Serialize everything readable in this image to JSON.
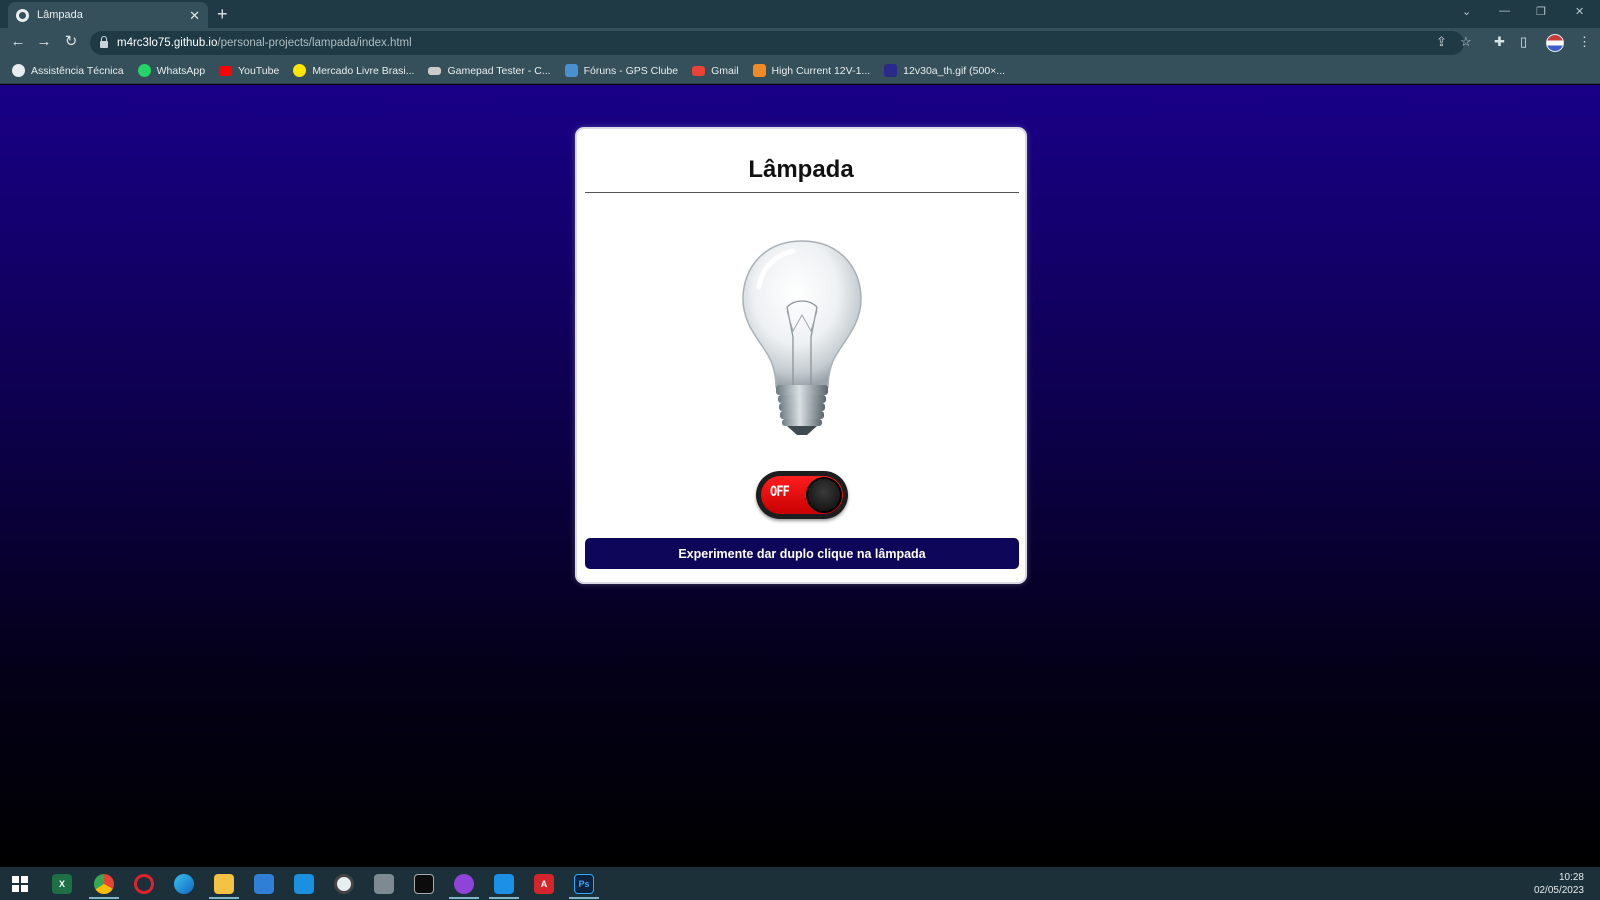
{
  "browser": {
    "tab_title": "Lâmpada",
    "tab_close": "✕",
    "new_tab": "+",
    "url_host": "m4rc3lo75.github.io",
    "url_path": "/personal-projects/lampada/index.html"
  },
  "bookmarks": [
    {
      "label": "Assistência Técnica",
      "icon": "globe-icon",
      "color": "#e8eef0"
    },
    {
      "label": "WhatsApp",
      "icon": "whatsapp-icon",
      "color": "#25d366"
    },
    {
      "label": "YouTube",
      "icon": "youtube-icon",
      "color": "#ff0000"
    },
    {
      "label": "Mercado Livre Brasi...",
      "icon": "mercado-livre-icon",
      "color": "#ffe600"
    },
    {
      "label": "Gamepad Tester - C...",
      "icon": "gamepad-icon",
      "color": "#cccccc"
    },
    {
      "label": "Fóruns - GPS Clube",
      "icon": "gps-clube-icon",
      "color": "#4a8fd0"
    },
    {
      "label": "Gmail",
      "icon": "gmail-icon",
      "color": "#ea4335"
    },
    {
      "label": "High Current 12V-1...",
      "icon": "bookmark-orange-icon",
      "color": "#f08a24"
    },
    {
      "label": "12v30a_th.gif (500×...",
      "icon": "image-file-icon",
      "color": "#2a2a8a"
    }
  ],
  "page": {
    "title": "Lâmpada",
    "switch_label": "OFF",
    "switch_state": "off",
    "hint": "Experimente dar duplo clique na lâmpada"
  },
  "taskbar": {
    "apps": [
      "windows-start-icon",
      "excel-icon",
      "chrome-icon",
      "opera-icon",
      "edge-icon",
      "file-explorer-icon",
      "store-icon",
      "mail-icon",
      "obs-icon",
      "camera-icon",
      "terminal-icon",
      "github-icon",
      "vscode-icon",
      "acrobat-icon",
      "photoshop-icon"
    ],
    "time": "10:28",
    "date": "02/05/2023"
  },
  "colors": {
    "page_gradient_top": "#190087",
    "page_gradient_bottom": "#000000",
    "hint_bar": "#0e0658",
    "switch_off": "#e00000"
  }
}
